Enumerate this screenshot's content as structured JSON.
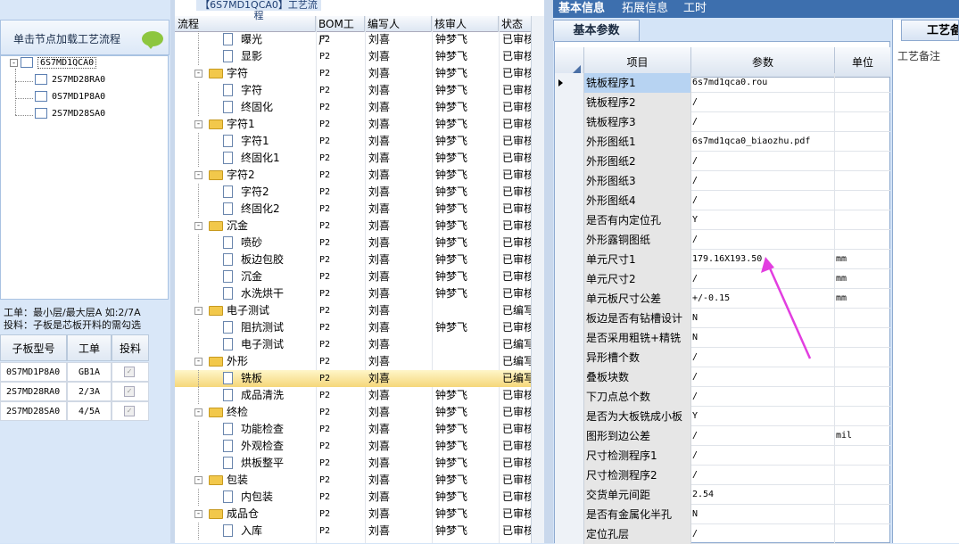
{
  "left": {
    "load_label": "单击节点加载工艺流程",
    "tree": {
      "root": "6S7MD1QCA0",
      "children": [
        "2S7MD28RA0",
        "0S7MD1P8A0",
        "2S7MD28SA0"
      ]
    },
    "hint_line1": "工单：最小层/最大层A 如:2/7A",
    "hint_line2": "投料：子板是芯板开料的需勾选",
    "sub_table": {
      "headers": [
        "子板型号",
        "工单",
        "投料"
      ],
      "rows": [
        {
          "model": "0S7MD1P8A0",
          "order": "GB1A",
          "feed": "✓"
        },
        {
          "model": "2S7MD28RA0",
          "order": "2/3A",
          "feed": "✓"
        },
        {
          "model": "2S7MD28SA0",
          "order": "4/5A",
          "feed": "✓"
        }
      ]
    }
  },
  "flow": {
    "title": "【6S7MD1QCA0】工艺流程",
    "headers": [
      "流程",
      "BOM工厂",
      "编写人",
      "核审人",
      "状态"
    ],
    "rows": [
      {
        "name": "曝光",
        "bom": "P2",
        "writer": "刘喜",
        "reviewer": "钟梦飞",
        "status": "已审核",
        "kind": "item"
      },
      {
        "name": "显影",
        "bom": "P2",
        "writer": "刘喜",
        "reviewer": "钟梦飞",
        "status": "已审核",
        "kind": "item"
      },
      {
        "name": "字符",
        "bom": "P2",
        "writer": "刘喜",
        "reviewer": "钟梦飞",
        "status": "已审核",
        "kind": "group"
      },
      {
        "name": "字符",
        "bom": "P2",
        "writer": "刘喜",
        "reviewer": "钟梦飞",
        "status": "已审核",
        "kind": "item"
      },
      {
        "name": "终固化",
        "bom": "P2",
        "writer": "刘喜",
        "reviewer": "钟梦飞",
        "status": "已审核",
        "kind": "item"
      },
      {
        "name": "字符1",
        "bom": "P2",
        "writer": "刘喜",
        "reviewer": "钟梦飞",
        "status": "已审核",
        "kind": "group"
      },
      {
        "name": "字符1",
        "bom": "P2",
        "writer": "刘喜",
        "reviewer": "钟梦飞",
        "status": "已审核",
        "kind": "item"
      },
      {
        "name": "终固化1",
        "bom": "P2",
        "writer": "刘喜",
        "reviewer": "钟梦飞",
        "status": "已审核",
        "kind": "item"
      },
      {
        "name": "字符2",
        "bom": "P2",
        "writer": "刘喜",
        "reviewer": "钟梦飞",
        "status": "已审核",
        "kind": "group"
      },
      {
        "name": "字符2",
        "bom": "P2",
        "writer": "刘喜",
        "reviewer": "钟梦飞",
        "status": "已审核",
        "kind": "item"
      },
      {
        "name": "终固化2",
        "bom": "P2",
        "writer": "刘喜",
        "reviewer": "钟梦飞",
        "status": "已审核",
        "kind": "item"
      },
      {
        "name": "沉金",
        "bom": "P2",
        "writer": "刘喜",
        "reviewer": "钟梦飞",
        "status": "已审核",
        "kind": "group"
      },
      {
        "name": "喷砂",
        "bom": "P2",
        "writer": "刘喜",
        "reviewer": "钟梦飞",
        "status": "已审核",
        "kind": "item"
      },
      {
        "name": "板边包胶",
        "bom": "P2",
        "writer": "刘喜",
        "reviewer": "钟梦飞",
        "status": "已审核",
        "kind": "item"
      },
      {
        "name": "沉金",
        "bom": "P2",
        "writer": "刘喜",
        "reviewer": "钟梦飞",
        "status": "已审核",
        "kind": "item"
      },
      {
        "name": "水洗烘干",
        "bom": "P2",
        "writer": "刘喜",
        "reviewer": "钟梦飞",
        "status": "已审核",
        "kind": "item"
      },
      {
        "name": "电子测试",
        "bom": "P2",
        "writer": "刘喜",
        "reviewer": "",
        "status": "已编写",
        "kind": "group"
      },
      {
        "name": "阻抗测试",
        "bom": "P2",
        "writer": "刘喜",
        "reviewer": "钟梦飞",
        "status": "已审核",
        "kind": "item"
      },
      {
        "name": "电子测试",
        "bom": "P2",
        "writer": "刘喜",
        "reviewer": "",
        "status": "已编写",
        "kind": "item"
      },
      {
        "name": "外形",
        "bom": "P2",
        "writer": "刘喜",
        "reviewer": "",
        "status": "已编写",
        "kind": "group"
      },
      {
        "name": "铣板",
        "bom": "P2",
        "writer": "刘喜",
        "reviewer": "",
        "status": "已编写",
        "kind": "item",
        "selected": true
      },
      {
        "name": "成品清洗",
        "bom": "P2",
        "writer": "刘喜",
        "reviewer": "钟梦飞",
        "status": "已审核",
        "kind": "item"
      },
      {
        "name": "终检",
        "bom": "P2",
        "writer": "刘喜",
        "reviewer": "钟梦飞",
        "status": "已审核",
        "kind": "group"
      },
      {
        "name": "功能检查",
        "bom": "P2",
        "writer": "刘喜",
        "reviewer": "钟梦飞",
        "status": "已审核",
        "kind": "item"
      },
      {
        "name": "外观检查",
        "bom": "P2",
        "writer": "刘喜",
        "reviewer": "钟梦飞",
        "status": "已审核",
        "kind": "item"
      },
      {
        "name": "烘板整平",
        "bom": "P2",
        "writer": "刘喜",
        "reviewer": "钟梦飞",
        "status": "已审核",
        "kind": "item"
      },
      {
        "name": "包装",
        "bom": "P2",
        "writer": "刘喜",
        "reviewer": "钟梦飞",
        "status": "已审核",
        "kind": "group"
      },
      {
        "name": "内包装",
        "bom": "P2",
        "writer": "刘喜",
        "reviewer": "钟梦飞",
        "status": "已审核",
        "kind": "item"
      },
      {
        "name": "成品仓",
        "bom": "P2",
        "writer": "刘喜",
        "reviewer": "钟梦飞",
        "status": "已审核",
        "kind": "group"
      },
      {
        "name": "入库",
        "bom": "P2",
        "writer": "刘喜",
        "reviewer": "钟梦飞",
        "status": "已审核",
        "kind": "item"
      }
    ]
  },
  "right": {
    "tabs": [
      "基本信息",
      "拓展信息",
      "工时"
    ],
    "sub_tab": "基本参数",
    "grid_headers": [
      "项目",
      "参数",
      "单位"
    ],
    "rows": [
      {
        "item": "铣板程序1",
        "param": "6s7md1qca0.rou",
        "unit": ""
      },
      {
        "item": "铣板程序2",
        "param": "/",
        "unit": ""
      },
      {
        "item": "铣板程序3",
        "param": "/",
        "unit": ""
      },
      {
        "item": "外形图纸1",
        "param": "6s7md1qca0_biaozhu.pdf",
        "unit": ""
      },
      {
        "item": "外形图纸2",
        "param": "/",
        "unit": ""
      },
      {
        "item": "外形图纸3",
        "param": "/",
        "unit": ""
      },
      {
        "item": "外形图纸4",
        "param": "/",
        "unit": ""
      },
      {
        "item": "是否有内定位孔",
        "param": "Y",
        "unit": ""
      },
      {
        "item": "外形露铜图纸",
        "param": "/",
        "unit": ""
      },
      {
        "item": "单元尺寸1",
        "param": "179.16X193.50",
        "unit": "mm"
      },
      {
        "item": "单元尺寸2",
        "param": "/",
        "unit": "mm"
      },
      {
        "item": "单元板尺寸公差",
        "param": "+/-0.15",
        "unit": "mm"
      },
      {
        "item": "板边是否有钻槽设计",
        "param": "N",
        "unit": ""
      },
      {
        "item": "是否采用粗铣+精铣",
        "param": "N",
        "unit": ""
      },
      {
        "item": "异形槽个数",
        "param": "/",
        "unit": ""
      },
      {
        "item": "叠板块数",
        "param": "/",
        "unit": ""
      },
      {
        "item": "下刀点总个数",
        "param": "/",
        "unit": ""
      },
      {
        "item": "是否为大板铣成小板",
        "param": "Y",
        "unit": ""
      },
      {
        "item": "图形到边公差",
        "param": "/",
        "unit": "mil"
      },
      {
        "item": "尺寸检测程序1",
        "param": "/",
        "unit": ""
      },
      {
        "item": "尺寸检测程序2",
        "param": "/",
        "unit": ""
      },
      {
        "item": "交货单元间距",
        "param": "2.54",
        "unit": ""
      },
      {
        "item": "是否有金属化半孔",
        "param": "N",
        "unit": ""
      },
      {
        "item": "定位孔层",
        "param": "/",
        "unit": ""
      }
    ],
    "craft_tab": "工艺备",
    "craft_label": "工艺备注"
  },
  "colors": {
    "accent": "#3d6fae",
    "arrow": "#e23ee0",
    "selected_row": "#f5d77a"
  }
}
